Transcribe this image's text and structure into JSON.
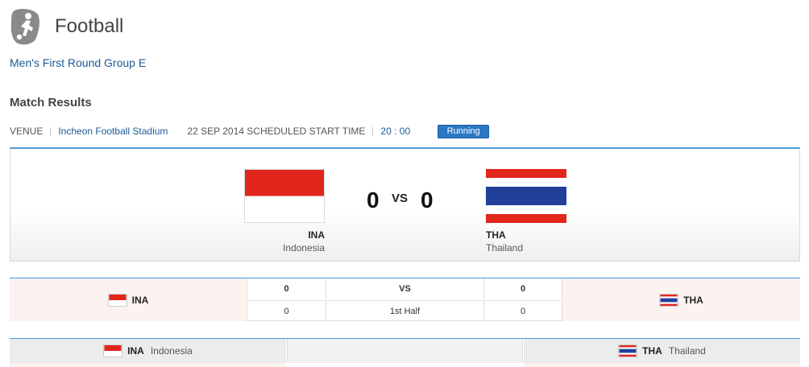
{
  "header": {
    "sport_icon": "football-player-icon",
    "sport_title": "Football"
  },
  "event": {
    "name": "Men's First Round Group E"
  },
  "section": {
    "title": "Match Results"
  },
  "meta": {
    "venue_label": "VENUE",
    "venue_value": "Incheon Football Stadium",
    "date_label": "22 SEP 2014 SCHEDULED START TIME",
    "time_value": "20 : 00",
    "status": "Running"
  },
  "match": {
    "home": {
      "code": "INA",
      "name": "Indonesia",
      "score": "0",
      "flag": "indonesia-flag-icon"
    },
    "away": {
      "code": "THA",
      "name": "Thailand",
      "score": "0",
      "flag": "thailand-flag-icon"
    },
    "vs_label": "VS"
  },
  "periods": {
    "header": {
      "home": "0",
      "label": "VS",
      "away": "0"
    },
    "rows": [
      {
        "home": "0",
        "label": "1st Half",
        "away": "0"
      }
    ]
  },
  "lineup": {
    "home": {
      "code": "INA",
      "name": "Indonesia"
    },
    "away": {
      "code": "THA",
      "name": "Thailand"
    }
  },
  "colors": {
    "accent": "#2b77c3",
    "link": "#1d5a96",
    "indonesia_red": "#e1261c",
    "thailand_red": "#e1261c",
    "thailand_blue": "#223f9a"
  }
}
